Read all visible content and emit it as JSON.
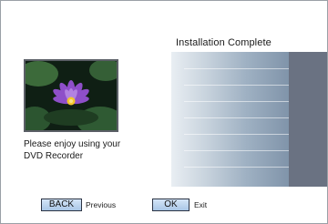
{
  "screen": {
    "title": "Installation Complete",
    "message": "Please enjoy using your DVD Recorder",
    "image": {
      "subject": "purple water lily",
      "icon": "lotus-photo"
    }
  },
  "controls": {
    "back_label": "BACK",
    "back_hint": "Previous",
    "ok_label": "OK",
    "ok_hint": "Exit"
  },
  "colors": {
    "button_fill": "#b9d3ef",
    "button_border": "#2c3444",
    "panel_gradient_start": "#e9eef3",
    "panel_gradient_end": "#7e92a8",
    "panel_right": "#6a7282"
  }
}
